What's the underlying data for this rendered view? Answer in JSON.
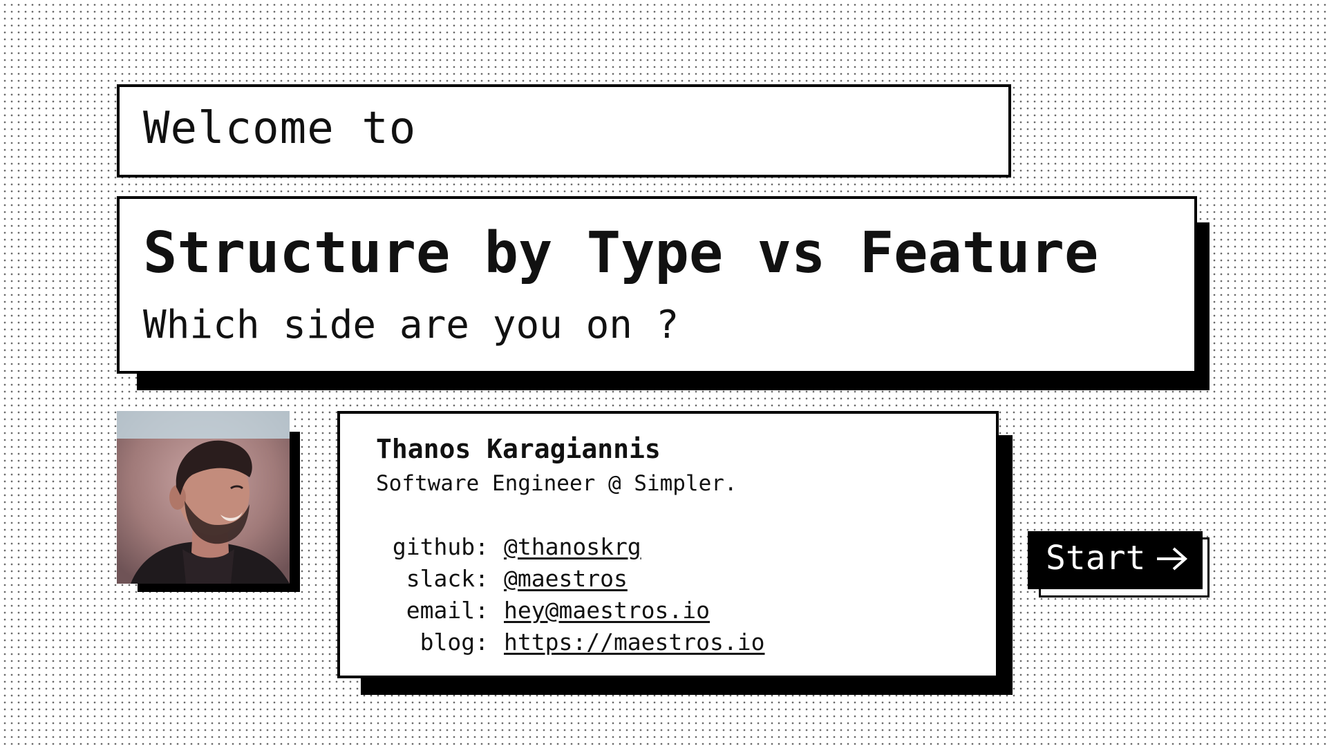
{
  "header": {
    "welcome": "Welcome to"
  },
  "hero": {
    "title": "Structure by Type vs Feature",
    "subtitle": "Which side are you on ?"
  },
  "profile": {
    "name": "Thanos Karagiannis",
    "role": "Software Engineer @ Simpler.",
    "contacts": [
      {
        "label": "github:",
        "value": "@thanoskrg"
      },
      {
        "label": "slack:",
        "value": "@maestros"
      },
      {
        "label": "email:",
        "value": "hey@maestros.io"
      },
      {
        "label": "blog:",
        "value": "https://maestros.io"
      }
    ]
  },
  "start_button": {
    "label": "Start",
    "icon": "arrow-right-icon"
  },
  "colors": {
    "background": "#ffffff",
    "ink": "#000000",
    "dot": "#6a6a6a"
  }
}
